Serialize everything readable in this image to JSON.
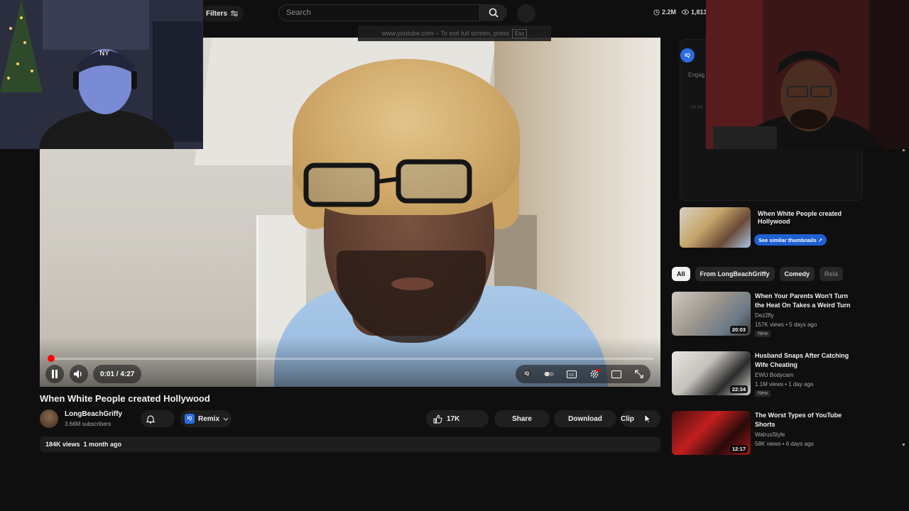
{
  "topbar": {
    "filters_label": "Filters",
    "search_placeholder": "Search",
    "stat_views": "2.2M",
    "stat_viewers": "1,813"
  },
  "fullscreen_hint": {
    "text": "www.youtube.com – To exit full screen, press",
    "key": "Esc"
  },
  "player": {
    "time": "0:01 / 4:27",
    "progress": 0.004,
    "state": "playing"
  },
  "video": {
    "title": "When White People created Hollywood",
    "channel": "LongBeachGriffy",
    "subscribers": "3.66M subscribers",
    "remix_label": "Remix",
    "likes": "17K",
    "share_label": "Share",
    "download_label": "Download",
    "clip_label": "Clip",
    "views": "184K views",
    "age": "1 month ago"
  },
  "side_panel": {
    "iq_label": "IQ",
    "engage_text": "Engag",
    "hours_text": "24 ho"
  },
  "thumb_card": {
    "title": "When White People created Hollywood",
    "button_label": "See similar thumbnails ↗"
  },
  "chips": [
    "All",
    "From LongBeachGriffy",
    "Comedy",
    "Rela"
  ],
  "recommendations": [
    {
      "title": "When Your Parents Won't Turn the Heat On Takes a Weird Turn",
      "channel": "Dez2fly",
      "meta": "157K views • 5 days ago",
      "badge": "New",
      "duration": "20:03"
    },
    {
      "title": "Husband Snaps After Catching Wife Cheating",
      "channel": "EWU Bodycam",
      "meta": "1.1M views • 1 day ago",
      "badge": "New",
      "duration": "22:34"
    },
    {
      "title": "The Worst Types of YouTube Shorts",
      "channel": "WalrusStyle",
      "meta": "58K views • 6 days ago",
      "badge": "",
      "duration": "12:17"
    }
  ],
  "colors": {
    "background": "#0f0f0f",
    "accent_red": "#ff0000",
    "iq_blue": "#2d6cdf"
  }
}
